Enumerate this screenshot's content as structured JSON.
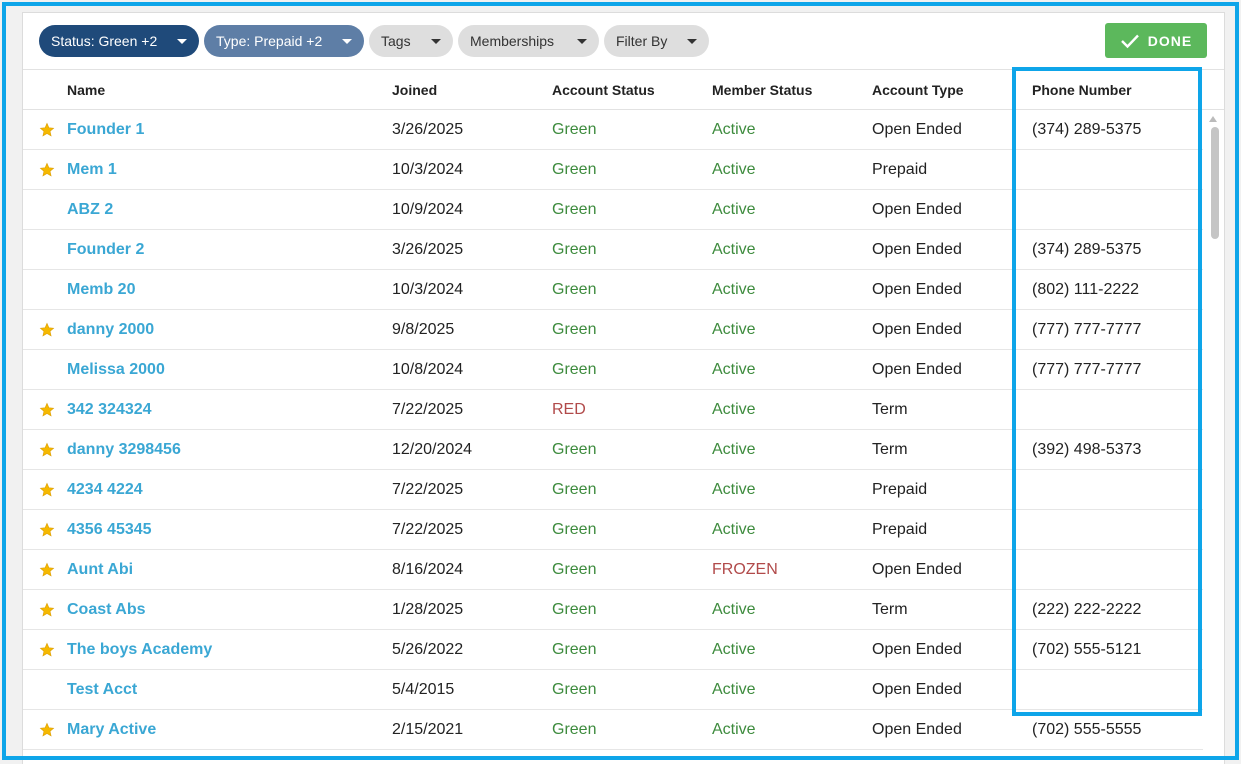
{
  "filters": [
    {
      "label": "Status: Green +2"
    },
    {
      "label": "Type: Prepaid +2"
    },
    {
      "label": "Tags"
    },
    {
      "label": "Memberships"
    },
    {
      "label": "Filter By"
    }
  ],
  "done_label": "DONE",
  "columns": {
    "name": "Name",
    "joined": "Joined",
    "account_status": "Account Status",
    "member_status": "Member Status",
    "account_type": "Account Type",
    "phone": "Phone Number"
  },
  "rows": [
    {
      "starred": true,
      "name": "Founder 1",
      "joined": "3/26/2025",
      "account_status": "Green",
      "member_status": "Active",
      "account_type": "Open Ended",
      "phone": "(374) 289-5375"
    },
    {
      "starred": true,
      "name": "Mem 1",
      "joined": "10/3/2024",
      "account_status": "Green",
      "member_status": "Active",
      "account_type": "Prepaid",
      "phone": ""
    },
    {
      "starred": false,
      "name": "ABZ 2",
      "joined": "10/9/2024",
      "account_status": "Green",
      "member_status": "Active",
      "account_type": "Open Ended",
      "phone": ""
    },
    {
      "starred": false,
      "name": "Founder 2",
      "joined": "3/26/2025",
      "account_status": "Green",
      "member_status": "Active",
      "account_type": "Open Ended",
      "phone": "(374) 289-5375"
    },
    {
      "starred": false,
      "name": "Memb 20",
      "joined": "10/3/2024",
      "account_status": "Green",
      "member_status": "Active",
      "account_type": "Open Ended",
      "phone": "(802) 111-2222"
    },
    {
      "starred": true,
      "name": "danny 2000",
      "joined": "9/8/2025",
      "account_status": "Green",
      "member_status": "Active",
      "account_type": "Open Ended",
      "phone": "(777) 777-7777"
    },
    {
      "starred": false,
      "name": "Melissa 2000",
      "joined": "10/8/2024",
      "account_status": "Green",
      "member_status": "Active",
      "account_type": "Open Ended",
      "phone": "(777) 777-7777"
    },
    {
      "starred": true,
      "name": "342 324324",
      "joined": "7/22/2025",
      "account_status": "RED",
      "member_status": "Active",
      "account_type": "Term",
      "phone": ""
    },
    {
      "starred": true,
      "name": "danny 3298456",
      "joined": "12/20/2024",
      "account_status": "Green",
      "member_status": "Active",
      "account_type": "Term",
      "phone": "(392) 498-5373"
    },
    {
      "starred": true,
      "name": "4234 4224",
      "joined": "7/22/2025",
      "account_status": "Green",
      "member_status": "Active",
      "account_type": "Prepaid",
      "phone": ""
    },
    {
      "starred": true,
      "name": "4356 45345",
      "joined": "7/22/2025",
      "account_status": "Green",
      "member_status": "Active",
      "account_type": "Prepaid",
      "phone": ""
    },
    {
      "starred": true,
      "name": "Aunt Abi",
      "joined": "8/16/2024",
      "account_status": "Green",
      "member_status": "FROZEN",
      "account_type": "Open Ended",
      "phone": ""
    },
    {
      "starred": true,
      "name": "Coast Abs",
      "joined": "1/28/2025",
      "account_status": "Green",
      "member_status": "Active",
      "account_type": "Term",
      "phone": "(222) 222-2222"
    },
    {
      "starred": true,
      "name": "The boys Academy",
      "joined": "5/26/2022",
      "account_status": "Green",
      "member_status": "Active",
      "account_type": "Open Ended",
      "phone": "(702) 555-5121"
    },
    {
      "starred": false,
      "name": "Test Acct",
      "joined": "5/4/2015",
      "account_status": "Green",
      "member_status": "Active",
      "account_type": "Open Ended",
      "phone": ""
    },
    {
      "starred": true,
      "name": "Mary Active",
      "joined": "2/15/2021",
      "account_status": "Green",
      "member_status": "Active",
      "account_type": "Open Ended",
      "phone": "(702) 555-5555"
    }
  ],
  "colors": {
    "link": "#3aa7d4",
    "status_green": "#3d8b3d",
    "status_red": "#b14a4a",
    "done_button": "#5cb85c",
    "highlight": "#0ea5e9",
    "star": "#f5b800"
  }
}
